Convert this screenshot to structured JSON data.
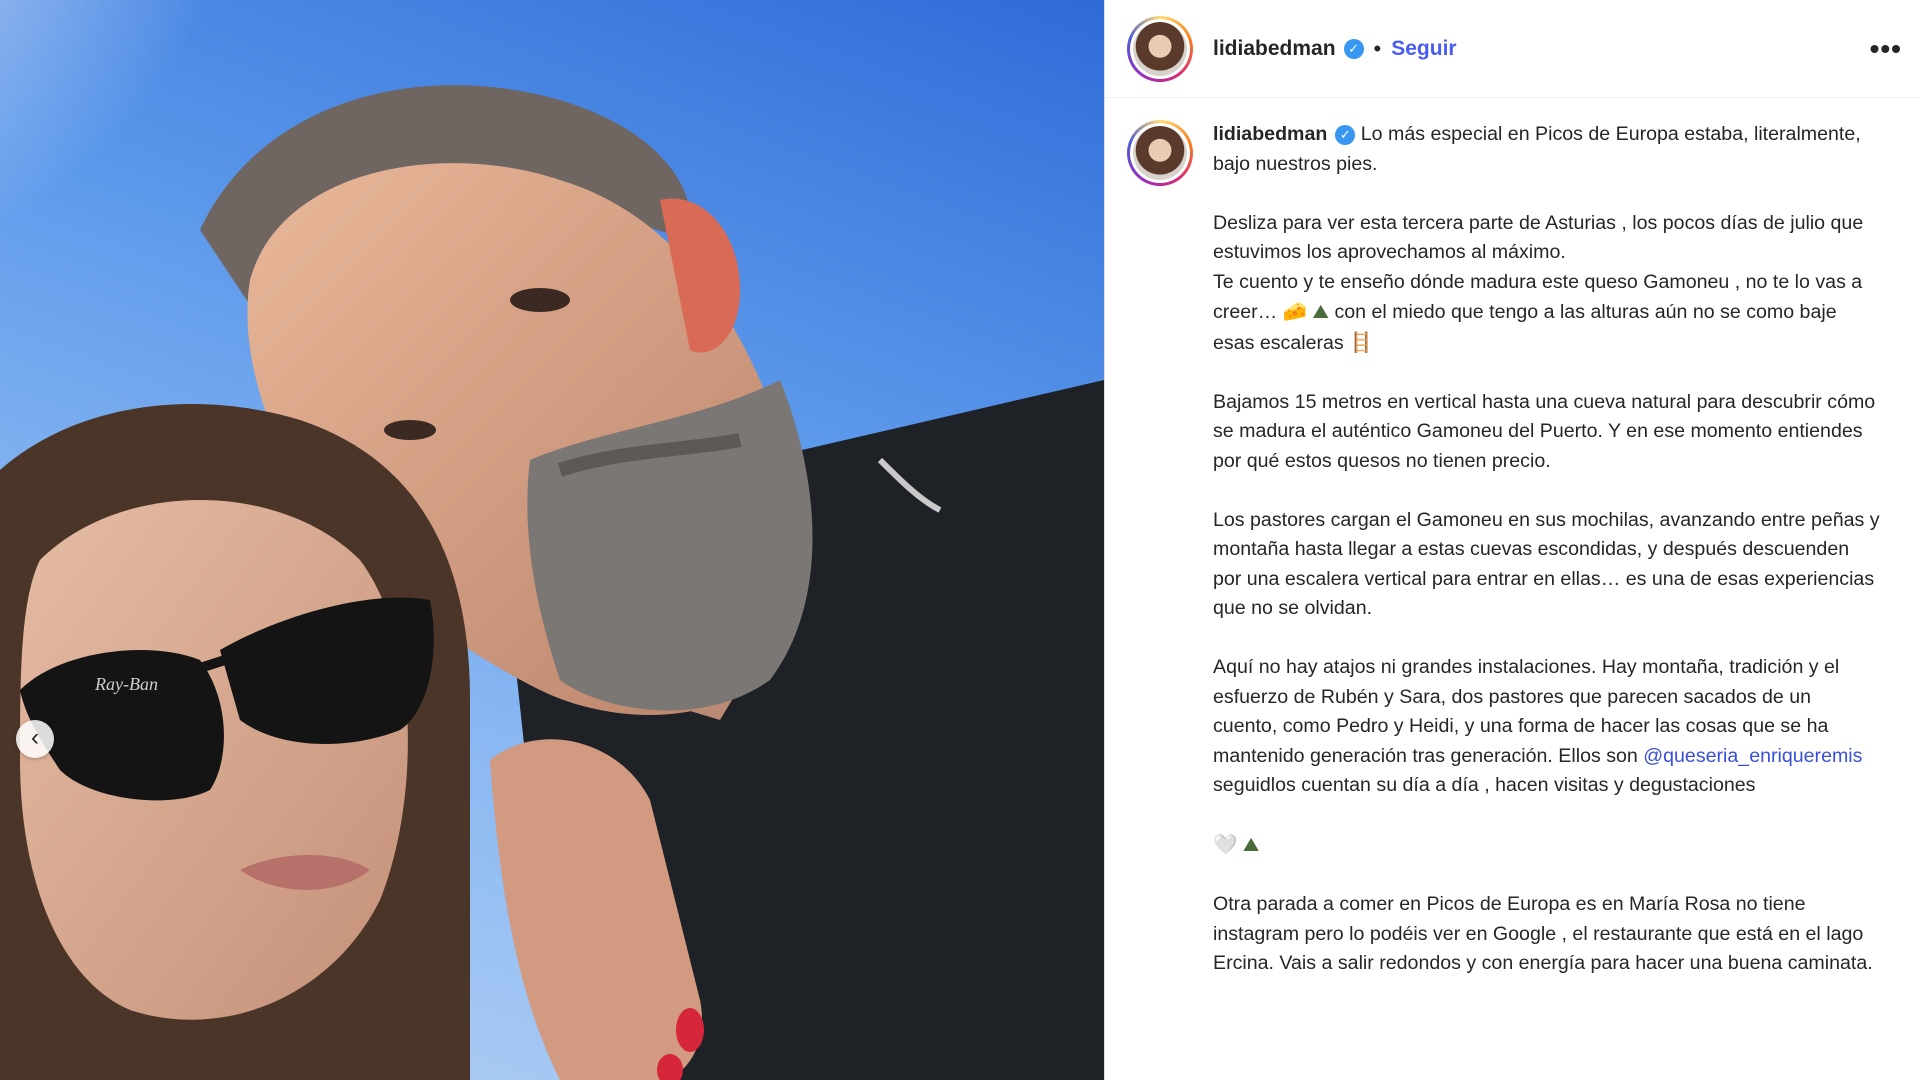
{
  "header": {
    "username": "lidiabedman",
    "separator": "•",
    "follow_label": "Seguir",
    "more_label": "•••",
    "verified_icon": "verified-badge-icon"
  },
  "media": {
    "prev_icon": "chevron-left-icon",
    "prev_label": "‹",
    "sunglasses_brand": "Ray-Ban"
  },
  "caption": {
    "username": "lidiabedman",
    "intro": " Lo más especial en Picos de Europa estaba, literalmente, bajo nuestros pies.",
    "p1_line1": "Desliza para ver esta tercera parte de Asturias , los pocos días de julio que estuvimos los aprovechamos al máximo.",
    "p1_line2a": "Te cuento y te enseño dónde madura este queso Gamoneu , no te lo vas a creer… ",
    "p1_line2b": " con el miedo que tengo a las alturas aún no se como baje esas escaleras ",
    "p2": "Bajamos 15 metros en vertical hasta una cueva natural para descubrir cómo se madura el auténtico Gamoneu del Puerto. Y en ese momento entiendes por qué estos quesos no tienen precio.",
    "p3": "Los pastores cargan el Gamoneu en sus mochilas, avanzando entre peñas y montaña hasta llegar a estas cuevas escondidas, y después descuenden por una escalera vertical para entrar en ellas… es una de esas experiencias que no se olvidan.",
    "p4a": "Aquí no hay atajos ni grandes instalaciones. Hay montaña, tradición y el esfuerzo de Rubén y Sara, dos pastores que parecen sacados de un cuento, como Pedro y Heidi, y una forma de hacer las cosas que se ha mantenido generación tras generación. Ellos son ",
    "mention": "@queseria_enriqueremis",
    "p4b": " seguidlos cuentan su día a día , hacen visitas y degustaciones",
    "p6": "Otra parada a comer en Picos de Europa es en María Rosa no tiene instagram pero lo podéis ver en Google , el restaurante que está en el lago Ercina. Vais a salir redondos y con energía para hacer una buena caminata.",
    "emoji_cheese": "🧀",
    "emoji_mountain": "⛰",
    "emoji_ladder": "🪜",
    "emoji_heart": "🤍"
  },
  "colors": {
    "follow": "#4a5cf0",
    "mention": "#3a4fd8",
    "verified": "#3897f0",
    "sky": "#5a97ea"
  }
}
